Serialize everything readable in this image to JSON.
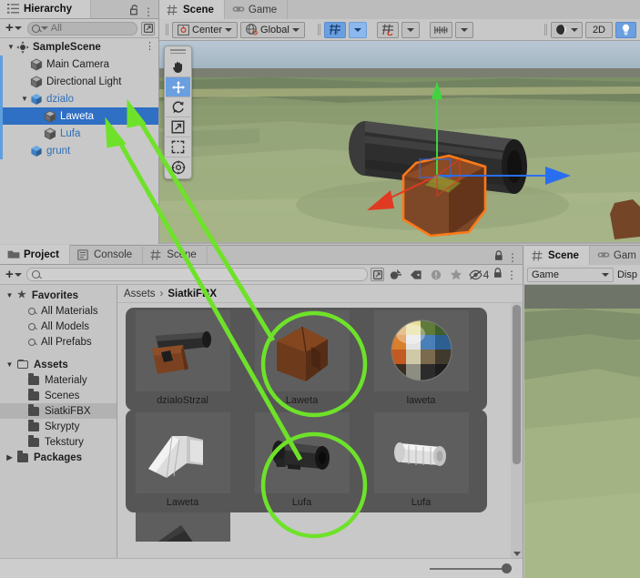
{
  "hierarchy": {
    "tab_label": "Hierarchy",
    "tab_icon": "hierarchy-list-icon",
    "lock_icon": "lock-open-icon",
    "menu_icon": "kebab-menu-icon",
    "add_label": "+",
    "search_placeholder": "All",
    "items": [
      {
        "label": "SampleScene",
        "depth": 0,
        "icon": "scene-icon",
        "expanded": true,
        "selected": false,
        "prefab": false,
        "kebab": true
      },
      {
        "label": "Main Camera",
        "depth": 1,
        "icon": "gameobject-cube-icon",
        "expanded": null,
        "selected": false,
        "prefab": false,
        "kebab": false
      },
      {
        "label": "Directional Light",
        "depth": 1,
        "icon": "gameobject-cube-icon",
        "expanded": null,
        "selected": false,
        "prefab": false,
        "kebab": false
      },
      {
        "label": "dzialo",
        "depth": 1,
        "icon": "prefab-cube-icon",
        "expanded": true,
        "selected": false,
        "prefab": true,
        "kebab": false
      },
      {
        "label": "Laweta",
        "depth": 2,
        "icon": "gameobject-cube-icon",
        "expanded": null,
        "selected": true,
        "prefab": false,
        "kebab": false
      },
      {
        "label": "Lufa",
        "depth": 2,
        "icon": "gameobject-cube-icon",
        "expanded": null,
        "selected": false,
        "prefab": true,
        "kebab": false
      },
      {
        "label": "grunt",
        "depth": 1,
        "icon": "prefab-cube-icon",
        "expanded": null,
        "selected": false,
        "prefab": true,
        "kebab": false
      }
    ]
  },
  "scene": {
    "tabs": [
      {
        "label": "Scene",
        "icon": "grid-hash-icon",
        "active": true
      },
      {
        "label": "Game",
        "icon": "gamepad-icon",
        "active": false
      }
    ],
    "toolbar": {
      "pivot_label": "Center",
      "pivot_icon": "pivot-center-icon",
      "space_label": "Global",
      "space_icon": "globe-icon",
      "grid_visibility_icon": "grid-axis-y-icon",
      "grid_snap_icon": "grid-snap-icon",
      "layout_icon": "grid-scale-icon",
      "lighting_icon": "shading-sphere-icon",
      "mode_2d_label": "2D",
      "light_icon": "lightbulb-icon"
    },
    "tools": [
      {
        "name": "hand-tool",
        "glyph": "hand",
        "active": false
      },
      {
        "name": "move-tool",
        "glyph": "move",
        "active": true
      },
      {
        "name": "rotate-tool",
        "glyph": "rotate",
        "active": false
      },
      {
        "name": "scale-tool",
        "glyph": "scale",
        "active": false
      },
      {
        "name": "rect-tool",
        "glyph": "rect",
        "active": false
      },
      {
        "name": "transform-tool",
        "glyph": "transform",
        "active": false
      }
    ],
    "gizmo": {
      "x_axis_color": "#e03a22",
      "y_axis_color": "#3fd43f",
      "z_axis_color": "#2a6ef0",
      "selection_outline": "#ff7a18"
    }
  },
  "project": {
    "tabs": [
      {
        "label": "Project",
        "icon": "folder-icon",
        "active": true
      },
      {
        "label": "Console",
        "icon": "console-icon",
        "active": false
      },
      {
        "label": "Scene",
        "icon": "grid-hash-icon",
        "active": false
      }
    ],
    "lock_icon": "lock-closed-icon",
    "menu_icon": "kebab-menu-icon",
    "add_label": "+",
    "search_placeholder": "",
    "filters": [
      {
        "name": "save-filter-icon",
        "dim": false
      },
      {
        "name": "package-filter-icon",
        "dim": false
      },
      {
        "name": "label-tag-icon",
        "dim": false
      },
      {
        "name": "warning-filter-icon",
        "dim": true
      },
      {
        "name": "favorite-star-icon",
        "dim": true
      },
      {
        "name": "hidden-packages-icon",
        "dim": false
      }
    ],
    "hidden_count": "4",
    "breadcrumb": [
      "Assets",
      "SiatkiFBX"
    ],
    "tree": [
      {
        "label": "Favorites",
        "depth": 0,
        "icon": "star-icon",
        "expanded": true,
        "bold": true,
        "selected": false
      },
      {
        "label": "All Materials",
        "depth": 1,
        "icon": "search-icon",
        "expanded": null,
        "bold": false,
        "selected": false
      },
      {
        "label": "All Models",
        "depth": 1,
        "icon": "search-icon",
        "expanded": null,
        "bold": false,
        "selected": false
      },
      {
        "label": "All Prefabs",
        "depth": 1,
        "icon": "search-icon",
        "expanded": null,
        "bold": false,
        "selected": false
      },
      {
        "label": "",
        "depth": 0,
        "icon": "spacer",
        "expanded": null,
        "bold": false,
        "selected": false
      },
      {
        "label": "Assets",
        "depth": 0,
        "icon": "folder-open-icon",
        "expanded": true,
        "bold": true,
        "selected": false
      },
      {
        "label": "Materialy",
        "depth": 1,
        "icon": "folder-icon",
        "expanded": null,
        "bold": false,
        "selected": false
      },
      {
        "label": "Scenes",
        "depth": 1,
        "icon": "folder-icon",
        "expanded": null,
        "bold": false,
        "selected": false
      },
      {
        "label": "SiatkiFBX",
        "depth": 1,
        "icon": "folder-icon",
        "expanded": null,
        "bold": false,
        "selected": true
      },
      {
        "label": "Skrypty",
        "depth": 1,
        "icon": "folder-icon",
        "expanded": null,
        "bold": false,
        "selected": false
      },
      {
        "label": "Tekstury",
        "depth": 1,
        "icon": "folder-icon",
        "expanded": null,
        "bold": false,
        "selected": false
      },
      {
        "label": "Packages",
        "depth": 0,
        "icon": "folder-icon",
        "expanded": false,
        "bold": true,
        "selected": false
      }
    ],
    "assets": [
      [
        {
          "label": "dzialoStrzal",
          "thumb": "cannon-model",
          "circled": false
        },
        {
          "label": "Laweta",
          "thumb": "carriage-model",
          "circled": true
        },
        {
          "label": "laweta",
          "thumb": "material-sphere",
          "circled": false
        }
      ],
      [
        {
          "label": "Laweta",
          "thumb": "carriage-white-model",
          "circled": false
        },
        {
          "label": "Lufa",
          "thumb": "barrel-model",
          "circled": true
        },
        {
          "label": "Lufa",
          "thumb": "barrel-white-model",
          "circled": false
        }
      ]
    ],
    "zoom_slider_value": "100"
  },
  "gamepanel": {
    "tabs": [
      {
        "label": "Scene",
        "icon": "grid-hash-icon",
        "active": true
      },
      {
        "label": "Gam",
        "icon": "gamepad-icon",
        "active": false
      }
    ],
    "display_dropdown": "Game",
    "display_label": "Disp"
  },
  "annotations": {
    "color": "#6ee22a",
    "shapes": [
      {
        "type": "circle-highlight",
        "target": "asset-Laweta"
      },
      {
        "type": "circle-highlight",
        "target": "asset-Lufa"
      },
      {
        "type": "arrow",
        "from": "asset-Laweta",
        "to": "hierarchy-Laweta"
      },
      {
        "type": "arrow",
        "from": "asset-Lufa",
        "to": "hierarchy-Lufa"
      }
    ]
  }
}
